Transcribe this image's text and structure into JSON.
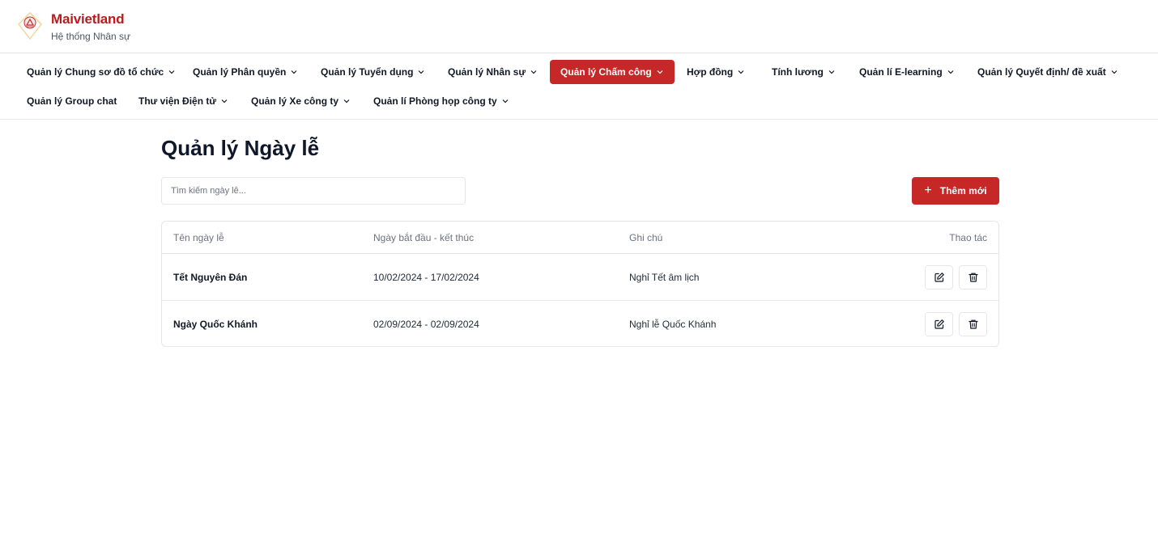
{
  "brand": {
    "name": "Maivietland",
    "subtitle": "Hệ thống Nhân sự"
  },
  "nav": {
    "items": [
      {
        "label": "Quản lý Chung sơ đồ tổ chức",
        "dropdown": true
      },
      {
        "label": "Quản lý Phân quyền",
        "dropdown": true
      },
      {
        "label": "Quản lý Tuyển dụng",
        "dropdown": true
      },
      {
        "label": "Quản lý Nhân sự",
        "dropdown": true
      },
      {
        "label": "Quản lý Chấm công",
        "dropdown": true,
        "active": true
      },
      {
        "label": "Hợp đồng",
        "dropdown": true
      },
      {
        "label": "Tính lương",
        "dropdown": true
      },
      {
        "label": "Quản lí E-learning",
        "dropdown": true
      },
      {
        "label": "Quản lý Quyết định/ đề xuất",
        "dropdown": true
      },
      {
        "label": "Quản lý Group chat",
        "dropdown": false
      },
      {
        "label": "Thư viện Điện tử",
        "dropdown": true
      },
      {
        "label": "Quản lý Xe công ty",
        "dropdown": true
      },
      {
        "label": "Quản lí Phòng họp công ty",
        "dropdown": true
      }
    ]
  },
  "page": {
    "title": "Quản lý Ngày lễ",
    "search_placeholder": "Tìm kiếm ngày lễ...",
    "search_value": "",
    "add_button": "Thêm mới"
  },
  "table": {
    "columns": [
      "Tên ngày lễ",
      "Ngày bắt đầu - kết thúc",
      "Ghi chú",
      "Thao tác"
    ],
    "rows": [
      {
        "name": "Tết Nguyên Đán",
        "range": "10/02/2024 - 17/02/2024",
        "note": "Nghỉ Tết âm lịch"
      },
      {
        "name": "Ngày Quốc Khánh",
        "range": "02/09/2024 - 02/09/2024",
        "note": "Nghỉ lễ Quốc Khánh"
      }
    ]
  },
  "icons": {
    "edit": "edit-icon",
    "delete": "trash-icon",
    "dropdown": "chevron-down-icon",
    "add": "plus-icon"
  },
  "colors": {
    "brand": "#b91c1c",
    "accent": "#c62828",
    "border": "#e5e7eb",
    "muted": "#6b7280"
  }
}
